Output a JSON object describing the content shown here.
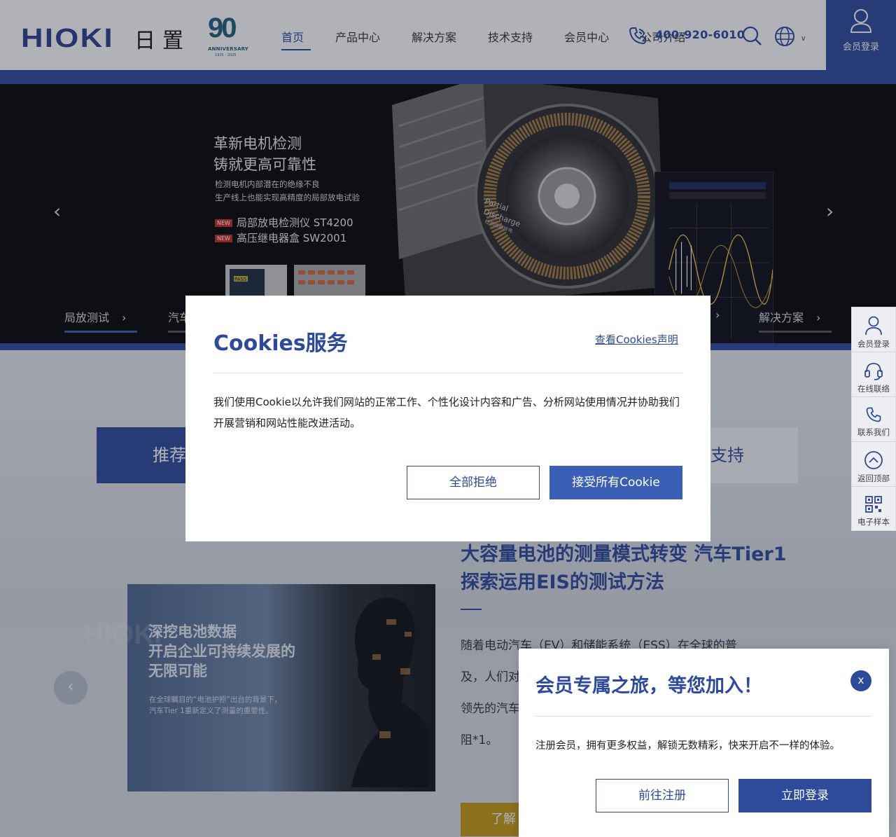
{
  "header": {
    "logo": "HIOKI",
    "logo_cn": "日置",
    "anniversary": {
      "number": "90",
      "text": "ANNIVERSARY",
      "years": "1935 - 2025"
    },
    "nav": [
      "首页",
      "产品中心",
      "解决方案",
      "技术支持",
      "会员中心",
      "公司介绍"
    ],
    "phone": "400-920-6010",
    "lang_chevron": "∨",
    "login_label": "会员登录"
  },
  "hero": {
    "headline_1": "革新电机检测",
    "headline_2": "铸就更高可靠性",
    "sub_1": "检测电机内部潜在的绝缘不良",
    "sub_2": "生产线上也能实现高精度的局部放电试验",
    "new_badge": "NEW",
    "product_1": "局部放电检测仪 ST4200",
    "product_2": "高压继电器盒 SW2001",
    "motor_label_1": "Partial",
    "motor_label_2": "Discharge",
    "motor_label_3": "检测局部放电",
    "pass_label": "PASS",
    "prev": "‹",
    "next": "›",
    "tabs": [
      "局放测试",
      "汽车",
      "解决方案"
    ],
    "tab_chevron": "›"
  },
  "section": {
    "tab_recommend": "推荐",
    "tab_support": "支持",
    "article_img_heading_1": "深挖电池数据",
    "article_img_heading_2": "开启企业可持续发展的",
    "article_img_heading_3": "无限可能",
    "article_img_sub_1": "在全球瞩目的“电池护照”出台的背景下，",
    "article_img_sub_2": "汽车Tier 1重新定义了测量的重要性。",
    "article_img_watermark": "HIOKI",
    "prev": "‹",
    "title": "大容量电池的测量模式转变 汽车Tier1探索运用EIS的测试方法",
    "body_1": "随着电动汽车（EV）和储能系统（ESS）在全球的普",
    "body_2": "及，人们对",
    "body_3": "领先的汽车",
    "body_4": "阻*1。",
    "more": "了解"
  },
  "sidebar": [
    {
      "label": "会员登录",
      "icon": "user-icon"
    },
    {
      "label": "在线联络",
      "icon": "headset-icon"
    },
    {
      "label": "联系我们",
      "icon": "phone-icon"
    },
    {
      "label": "返回顶部",
      "icon": "arrow-up-icon"
    },
    {
      "label": "电子样本",
      "icon": "qrcode-icon"
    }
  ],
  "cookie": {
    "title": "Cookies服务",
    "link": "查看Cookies声明",
    "text": "我们使用Cookie以允许我们网站的正常工作、个性化设计内容和广告、分析网站使用情况并协助我们开展营销和网站性能改进活动。",
    "reject": "全部拒绝",
    "accept": "接受所有Cookie"
  },
  "member": {
    "title": "会员专属之旅，等您加入！",
    "close": "x",
    "text": "注册会员，拥有更多权益，解锁无数精彩，快来开启不一样的体验。",
    "register": "前往注册",
    "login": "立即登录"
  },
  "colors": {
    "brand": "#2d4a9b",
    "accent": "#c79a13",
    "button_blue": "#3a5fb5"
  }
}
